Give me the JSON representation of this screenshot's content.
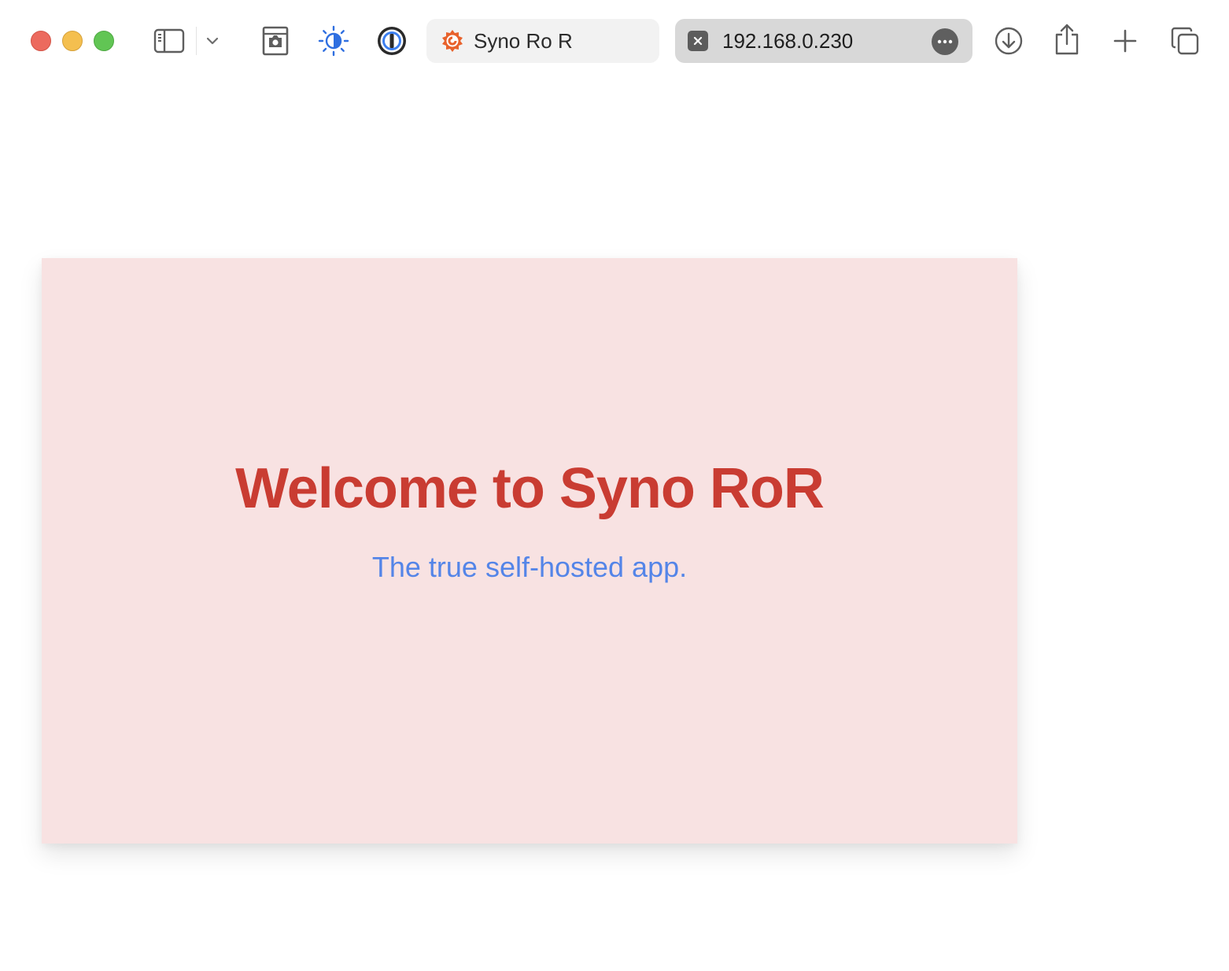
{
  "browser": {
    "tabs": [
      {
        "label": "Syno Ro R",
        "icon": "grafana-logo-icon",
        "active": false
      },
      {
        "label": "192.168.0.230",
        "icon": "close-icon",
        "active": true
      }
    ],
    "colors": {
      "close": "#ec6a5e",
      "minimize": "#f4bf4f",
      "maximize": "#61c554",
      "accent_blue": "#2f6fe0",
      "grafana_orange": "#e8622c"
    }
  },
  "page": {
    "title": "Welcome to Syno RoR",
    "subtitle": "The true self-hosted app.",
    "colors": {
      "hero_bg": "#f8e2e2",
      "title": "#c93c32",
      "subtitle": "#5485e8"
    }
  }
}
